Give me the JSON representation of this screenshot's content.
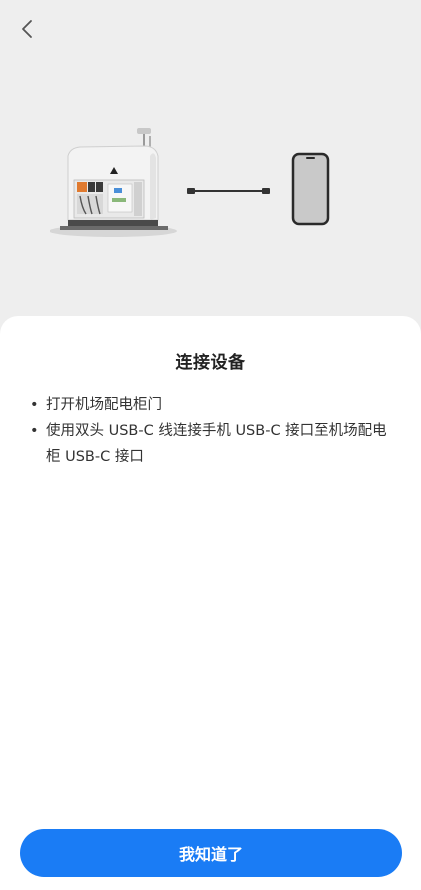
{
  "header": {
    "back_icon": "chevron-left-icon"
  },
  "illustration": {
    "device_icon": "dock-cabinet-image",
    "cable_icon": "usb-c-cable-icon",
    "phone_icon": "phone-icon"
  },
  "sheet": {
    "title": "连接设备",
    "instructions": [
      "打开机场配电柜门",
      "使用双头 USB-C 线连接手机 USB-C 接口至机场配电柜 USB-C 接口"
    ],
    "bullet": "•",
    "confirm_label": "我知道了"
  },
  "colors": {
    "primary": "#1a7cf5",
    "background": "#eeeeee",
    "sheet": "#ffffff",
    "text": "#333333"
  }
}
